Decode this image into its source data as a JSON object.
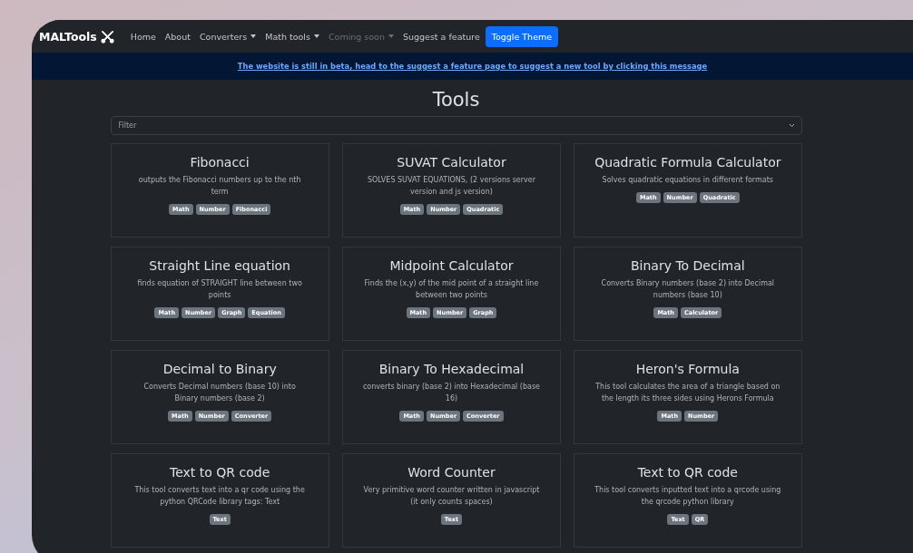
{
  "navbar": {
    "brand": "MALTools",
    "items": [
      {
        "label": "Home",
        "kind": "link",
        "disabled": false
      },
      {
        "label": "About",
        "kind": "link",
        "disabled": false
      },
      {
        "label": "Converters",
        "kind": "dropdown",
        "disabled": false
      },
      {
        "label": "Math tools",
        "kind": "dropdown",
        "disabled": false
      },
      {
        "label": "Coming soon",
        "kind": "dropdown",
        "disabled": true
      },
      {
        "label": "Suggest a feature",
        "kind": "link",
        "disabled": false
      },
      {
        "label": "Toggle Theme",
        "kind": "button"
      }
    ]
  },
  "banner": {
    "text": "The website is still in beta, head to the suggest a feature page to suggest a new tool by clicking this message"
  },
  "heading": "Tools",
  "filter": {
    "placeholder": "Filter"
  },
  "cards": [
    {
      "title": "Fibonacci",
      "description": "outputs the Fibonacci numbers up to the nth term",
      "tags": [
        "Math",
        "Number",
        "Fibonacci"
      ]
    },
    {
      "title": "SUVAT Calculator",
      "description": "SOLVES SUVAT EQUATIONS, (2 versions server version and js version)",
      "tags": [
        "Math",
        "Number",
        "Quadratic"
      ]
    },
    {
      "title": "Quadratic Formula Calculator",
      "description": "Solves quadratic equations in different formats",
      "tags": [
        "Math",
        "Number",
        "Quadratic"
      ]
    },
    {
      "title": "Straight Line equation",
      "description": "finds equation of STRAIGHT line between two points",
      "tags": [
        "Math",
        "Number",
        "Graph",
        "Equation"
      ]
    },
    {
      "title": "Midpoint Calculator",
      "description": "Finds the (x,y) of the mid point of a straight line between two points",
      "tags": [
        "Math",
        "Number",
        "Graph"
      ]
    },
    {
      "title": "Binary To Decimal",
      "description": "Converts Binary numbers (base 2) into Decimal numbers (base 10)",
      "tags": [
        "Math",
        "Calculator"
      ]
    },
    {
      "title": "Decimal to Binary",
      "description": "Converts Decimal numbers (base 10) into Binary numbers (base 2)",
      "tags": [
        "Math",
        "Number",
        "Converter"
      ]
    },
    {
      "title": "Binary To Hexadecimal",
      "description": "converts binary (base 2) into Hexadecimal (base 16)",
      "tags": [
        "Math",
        "Number",
        "Converter"
      ]
    },
    {
      "title": "Heron's Formula",
      "description": "This tool calculates the area of a triangle based on the length its three sides using Herons Formula",
      "tags": [
        "Math",
        "Number"
      ]
    },
    {
      "title": "Text to QR code",
      "description": "This tool converts text into a qr code using the python QRCode library tags: Text",
      "tags": [
        "Text"
      ]
    },
    {
      "title": "Word Counter",
      "description": "Very primitive word counter written in javascript (it only counts spaces)",
      "tags": [
        "Text"
      ]
    },
    {
      "title": "Text to QR code",
      "description": "This tool converts inputted text into a qrcode using the qrcode python library",
      "tags": [
        "Text",
        "QR"
      ]
    }
  ]
}
